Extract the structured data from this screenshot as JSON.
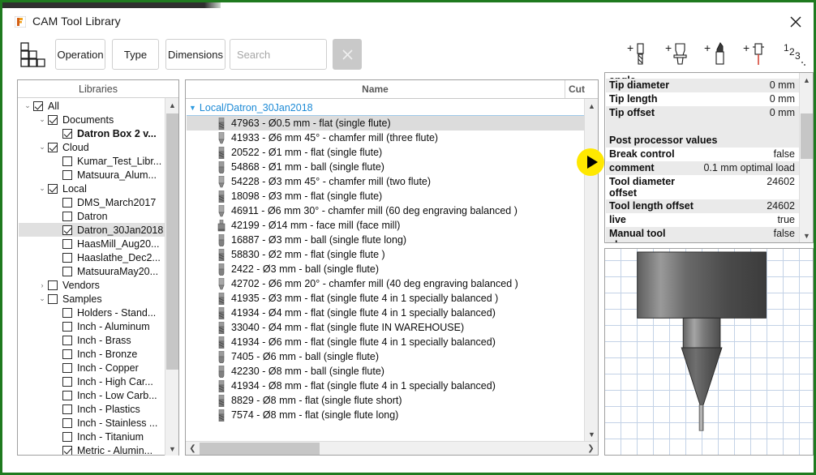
{
  "window": {
    "title": "CAM Tool Library",
    "close_label": "×",
    "accent_border": "#1f7a1f"
  },
  "toolbar": {
    "grid_icon": "grid-squares-icon",
    "filters": [
      {
        "label": "Operation",
        "id": "operation"
      },
      {
        "label": "Type",
        "id": "type"
      },
      {
        "label": "Dimensions",
        "id": "dimensions"
      }
    ],
    "search": {
      "value": "",
      "placeholder": "Search"
    },
    "clear_label": "×",
    "actions": [
      {
        "name": "add-tool-icon",
        "label": "+"
      },
      {
        "name": "add-holder-icon",
        "label": "+"
      },
      {
        "name": "add-insert-icon",
        "label": "+"
      },
      {
        "name": "add-probe-icon",
        "label": "+"
      },
      {
        "name": "numbering-icon",
        "label": "123"
      }
    ]
  },
  "libraries": {
    "header": "Libraries",
    "items": [
      {
        "label": "All",
        "indent": 0,
        "checked": true,
        "expanded": true,
        "hasArrow": true,
        "bold": false,
        "selected": false
      },
      {
        "label": "Documents",
        "indent": 1,
        "checked": true,
        "expanded": true,
        "hasArrow": true,
        "bold": false,
        "selected": false
      },
      {
        "label": "Datron Box 2 v...",
        "indent": 2,
        "checked": true,
        "expanded": false,
        "hasArrow": false,
        "bold": true,
        "selected": false
      },
      {
        "label": "Cloud",
        "indent": 1,
        "checked": true,
        "expanded": true,
        "hasArrow": true,
        "bold": false,
        "selected": false
      },
      {
        "label": "Kumar_Test_Libr...",
        "indent": 2,
        "checked": false,
        "expanded": false,
        "hasArrow": false,
        "bold": false,
        "selected": false
      },
      {
        "label": "Matsuura_Alum...",
        "indent": 2,
        "checked": false,
        "expanded": false,
        "hasArrow": false,
        "bold": false,
        "selected": false
      },
      {
        "label": "Local",
        "indent": 1,
        "checked": true,
        "expanded": true,
        "hasArrow": true,
        "bold": false,
        "selected": false
      },
      {
        "label": "DMS_March2017",
        "indent": 2,
        "checked": false,
        "expanded": false,
        "hasArrow": false,
        "bold": false,
        "selected": false
      },
      {
        "label": "Datron",
        "indent": 2,
        "checked": false,
        "expanded": false,
        "hasArrow": false,
        "bold": false,
        "selected": false
      },
      {
        "label": "Datron_30Jan2018",
        "indent": 2,
        "checked": true,
        "expanded": false,
        "hasArrow": false,
        "bold": false,
        "selected": true
      },
      {
        "label": "HaasMill_Aug20...",
        "indent": 2,
        "checked": false,
        "expanded": false,
        "hasArrow": false,
        "bold": false,
        "selected": false
      },
      {
        "label": "Haaslathe_Dec2...",
        "indent": 2,
        "checked": false,
        "expanded": false,
        "hasArrow": false,
        "bold": false,
        "selected": false
      },
      {
        "label": "MatsuuraMay20...",
        "indent": 2,
        "checked": false,
        "expanded": false,
        "hasArrow": false,
        "bold": false,
        "selected": false
      },
      {
        "label": "Vendors",
        "indent": 1,
        "checked": false,
        "expanded": false,
        "hasArrow": true,
        "bold": false,
        "selected": false
      },
      {
        "label": "Samples",
        "indent": 1,
        "checked": false,
        "expanded": true,
        "hasArrow": true,
        "bold": false,
        "selected": false
      },
      {
        "label": "Holders - Stand...",
        "indent": 2,
        "checked": false,
        "expanded": false,
        "hasArrow": false,
        "bold": false,
        "selected": false
      },
      {
        "label": "Inch - Aluminum",
        "indent": 2,
        "checked": false,
        "expanded": false,
        "hasArrow": false,
        "bold": false,
        "selected": false
      },
      {
        "label": "Inch - Brass",
        "indent": 2,
        "checked": false,
        "expanded": false,
        "hasArrow": false,
        "bold": false,
        "selected": false
      },
      {
        "label": "Inch - Bronze",
        "indent": 2,
        "checked": false,
        "expanded": false,
        "hasArrow": false,
        "bold": false,
        "selected": false
      },
      {
        "label": "Inch - Copper",
        "indent": 2,
        "checked": false,
        "expanded": false,
        "hasArrow": false,
        "bold": false,
        "selected": false
      },
      {
        "label": "Inch - High Car...",
        "indent": 2,
        "checked": false,
        "expanded": false,
        "hasArrow": false,
        "bold": false,
        "selected": false
      },
      {
        "label": "Inch - Low Carb...",
        "indent": 2,
        "checked": false,
        "expanded": false,
        "hasArrow": false,
        "bold": false,
        "selected": false
      },
      {
        "label": "Inch - Plastics",
        "indent": 2,
        "checked": false,
        "expanded": false,
        "hasArrow": false,
        "bold": false,
        "selected": false
      },
      {
        "label": "Inch - Stainless ...",
        "indent": 2,
        "checked": false,
        "expanded": false,
        "hasArrow": false,
        "bold": false,
        "selected": false
      },
      {
        "label": "Inch - Titanium",
        "indent": 2,
        "checked": false,
        "expanded": false,
        "hasArrow": false,
        "bold": false,
        "selected": false
      },
      {
        "label": "Metric - Alumin...",
        "indent": 2,
        "checked": true,
        "expanded": false,
        "hasArrow": false,
        "bold": false,
        "selected": false
      }
    ]
  },
  "toollist": {
    "columns": [
      {
        "label": "Name",
        "id": "name"
      },
      {
        "label": "Cut",
        "id": "cut"
      }
    ],
    "group": "Local/Datron_30Jan2018",
    "rows": [
      {
        "label": "47963 - Ø0.5 mm - flat (single flute)",
        "selected": true,
        "icon": "endmill-flat-icon"
      },
      {
        "label": "41933 - Ø6 mm 45° - chamfer mill (three flute)",
        "selected": false,
        "icon": "chamfer-mill-icon"
      },
      {
        "label": "20522 - Ø1 mm - flat (single flute)",
        "selected": false,
        "icon": "endmill-flat-icon"
      },
      {
        "label": "54868 - Ø1 mm - ball (single flute)",
        "selected": false,
        "icon": "ball-mill-icon"
      },
      {
        "label": "54228 - Ø3 mm 45° - chamfer mill (two flute)",
        "selected": false,
        "icon": "chamfer-mill-icon"
      },
      {
        "label": "18098 - Ø3 mm - flat (single flute)",
        "selected": false,
        "icon": "endmill-flat-icon"
      },
      {
        "label": "46911 - Ø6 mm 30° - chamfer mill (60 deg engraving balanced )",
        "selected": false,
        "icon": "chamfer-mill-icon"
      },
      {
        "label": "42199 - Ø14 mm - face mill (face mill)",
        "selected": false,
        "icon": "face-mill-icon"
      },
      {
        "label": "16887 - Ø3 mm - ball (single flute long)",
        "selected": false,
        "icon": "ball-mill-icon"
      },
      {
        "label": "58830 - Ø2 mm - flat (single flute )",
        "selected": false,
        "icon": "endmill-flat-icon"
      },
      {
        "label": "2422 - Ø3 mm - ball (single flute)",
        "selected": false,
        "icon": "ball-mill-icon"
      },
      {
        "label": "42702 - Ø6 mm 20° - chamfer mill (40 deg engraving balanced )",
        "selected": false,
        "icon": "chamfer-mill-icon"
      },
      {
        "label": "41935 - Ø3 mm - flat (single flute 4 in 1 specially balanced )",
        "selected": false,
        "icon": "endmill-flat-icon"
      },
      {
        "label": "41934 - Ø4 mm - flat (single flute 4 in 1 specially balanced)",
        "selected": false,
        "icon": "endmill-flat-icon"
      },
      {
        "label": "33040 - Ø4 mm - flat (single flute IN WAREHOUSE)",
        "selected": false,
        "icon": "endmill-flat-icon"
      },
      {
        "label": "41934 - Ø6 mm - flat (single flute 4 in 1 specially balanced)",
        "selected": false,
        "icon": "endmill-flat-icon"
      },
      {
        "label": "7405 - Ø6 mm - ball (single flute)",
        "selected": false,
        "icon": "ball-mill-icon"
      },
      {
        "label": "42230 - Ø8 mm - ball (single flute)",
        "selected": false,
        "icon": "ball-mill-icon"
      },
      {
        "label": "41934 - Ø8 mm - flat (single flute 4 in 1 specially balanced)",
        "selected": false,
        "icon": "endmill-flat-icon"
      },
      {
        "label": "8829 - Ø8 mm - flat (single flute short)",
        "selected": false,
        "icon": "endmill-flat-icon"
      },
      {
        "label": "7574 - Ø8 mm - flat (single flute long)",
        "selected": false,
        "icon": "endmill-flat-icon"
      }
    ]
  },
  "properties": {
    "rows": [
      {
        "key": "angle",
        "value": "",
        "clipped": true,
        "section": false
      },
      {
        "key": "Tip diameter",
        "value": "0 mm",
        "section": false
      },
      {
        "key": "Tip length",
        "value": "0 mm",
        "section": false
      },
      {
        "key": "Tip offset",
        "value": "0 mm",
        "section": false
      },
      {
        "key": "",
        "value": "",
        "section": false,
        "blank": true
      },
      {
        "key": "Post processor values",
        "value": "",
        "section": true
      },
      {
        "key": "Break control",
        "value": "false",
        "section": false
      },
      {
        "key": "comment",
        "value": "0.1 mm optimal load",
        "section": false
      },
      {
        "key": "Tool diameter offset",
        "value": "24602",
        "section": false
      },
      {
        "key": "Tool length offset",
        "value": "24602",
        "section": false
      },
      {
        "key": "live",
        "value": "true",
        "section": false
      },
      {
        "key": "Manual tool change",
        "value": "false",
        "section": false
      }
    ]
  },
  "preview": {
    "name": "tool-3d-preview",
    "grid_color": "#c3d2e6"
  },
  "annotation": {
    "play_badge": "play-triangle-icon",
    "badge_color": "#ffe800"
  }
}
